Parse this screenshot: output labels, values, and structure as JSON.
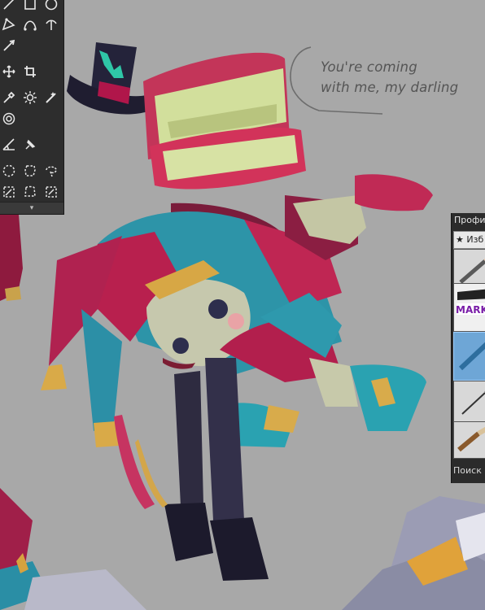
{
  "canvas": {
    "caption_lines": [
      "You're coming",
      "with me, my darling"
    ],
    "background_color": "#a7a7a7"
  },
  "toolbox": {
    "tools": [
      "line-tool",
      "rectangle-tool",
      "ellipse-tool",
      "pen-tool",
      "bezier-tool",
      "curve-tool",
      "brush-tool",
      "move-tool",
      "crop-tool",
      "eyedropper-tool",
      "magic-wand-tool",
      "smudge-tool",
      "spiral-tool",
      "ruler-tool",
      "pin-tool",
      "ellipse-select-tool",
      "freehand-select-tool",
      "lasso-tool",
      "transform-select-tool",
      "bucket-select-tool",
      "polygon-select-tool"
    ],
    "expand_glyph": "▾"
  },
  "brush_panel": {
    "title": "Профи",
    "tab_star": "★",
    "tab_label": "Изб",
    "brushes": [
      "pencil-brush",
      "marker-brush",
      "blue-pen-brush",
      "ink-pen-brush",
      "paint-brush"
    ],
    "marker_text": "MARK",
    "selected_index": 2,
    "search_label": "Поиск"
  }
}
